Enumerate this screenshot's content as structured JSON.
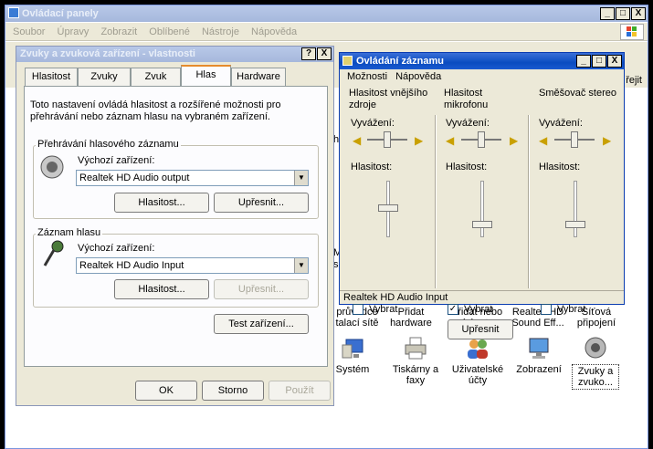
{
  "control_panel": {
    "title": "Ovládací panely",
    "menu": [
      "Soubor",
      "Úpravy",
      "Zobrazit",
      "Oblíbené",
      "Nástroje",
      "Nápověda"
    ],
    "side_text": "řejit",
    "icons_row1": [
      {
        "label": "průvodce\ntalací sítě"
      },
      {
        "label": "Přidat\nhardware"
      },
      {
        "label": "Přidat nebo\nodebrat ..."
      },
      {
        "label": "Realtek HD\nSound Eff..."
      },
      {
        "label": "Síťová\npřipojení"
      }
    ],
    "icons_row2": [
      {
        "label": "Systém"
      },
      {
        "label": "Tiskárny a\nfaxy"
      },
      {
        "label": "Uživatelské\núčty"
      },
      {
        "label": "Zobrazení"
      },
      {
        "label": "Zvuky a\nzvuko..."
      }
    ],
    "left_fragments": [
      "h",
      "M",
      "si"
    ]
  },
  "dialog": {
    "title": "Zvuky a zvuková zařízení - vlastnosti",
    "help_btn": "?",
    "close_btn": "X",
    "tabs": [
      "Hlasitost",
      "Zvuky",
      "Zvuk",
      "Hlas",
      "Hardware"
    ],
    "selected_tab": "Hlas",
    "description": "Toto nastavení ovládá hlasitost a rozšířené možnosti pro přehrávání nebo záznam hlasu na vybraném zařízení.",
    "playback": {
      "legend": "Přehrávání hlasového záznamu",
      "default_label": "Výchozí zařízení:",
      "device": "Realtek HD Audio output",
      "volume_btn": "Hlasitost...",
      "advanced_btn": "Upřesnit..."
    },
    "recording": {
      "legend": "Záznam hlasu",
      "default_label": "Výchozí zařízení:",
      "device": "Realtek HD Audio Input",
      "volume_btn": "Hlasitost...",
      "advanced_btn": "Upřesnit..."
    },
    "test_btn": "Test zařízení...",
    "ok": "OK",
    "cancel": "Storno",
    "apply": "Použít"
  },
  "mixer": {
    "title": "Ovládání záznamu",
    "menu": [
      "Možnosti",
      "Nápověda"
    ],
    "columns": [
      {
        "name": "Hlasitost vnějšího zdroje",
        "balance": "Vyvážení:",
        "volume": "Hlasitost:",
        "select": "Vybrat",
        "checked": false
      },
      {
        "name": "Hlasitost mikrofonu",
        "balance": "Vyvážení:",
        "volume": "Hlasitost:",
        "select": "Vybrat",
        "checked": true,
        "advanced": "Upřesnit"
      },
      {
        "name": "Směšovač stereo",
        "balance": "Vyvážení:",
        "volume": "Hlasitost:",
        "select": "Vybrat",
        "checked": false
      }
    ],
    "status": "Realtek HD Audio Input",
    "left_fragments": [
      "h",
      "l"
    ]
  }
}
